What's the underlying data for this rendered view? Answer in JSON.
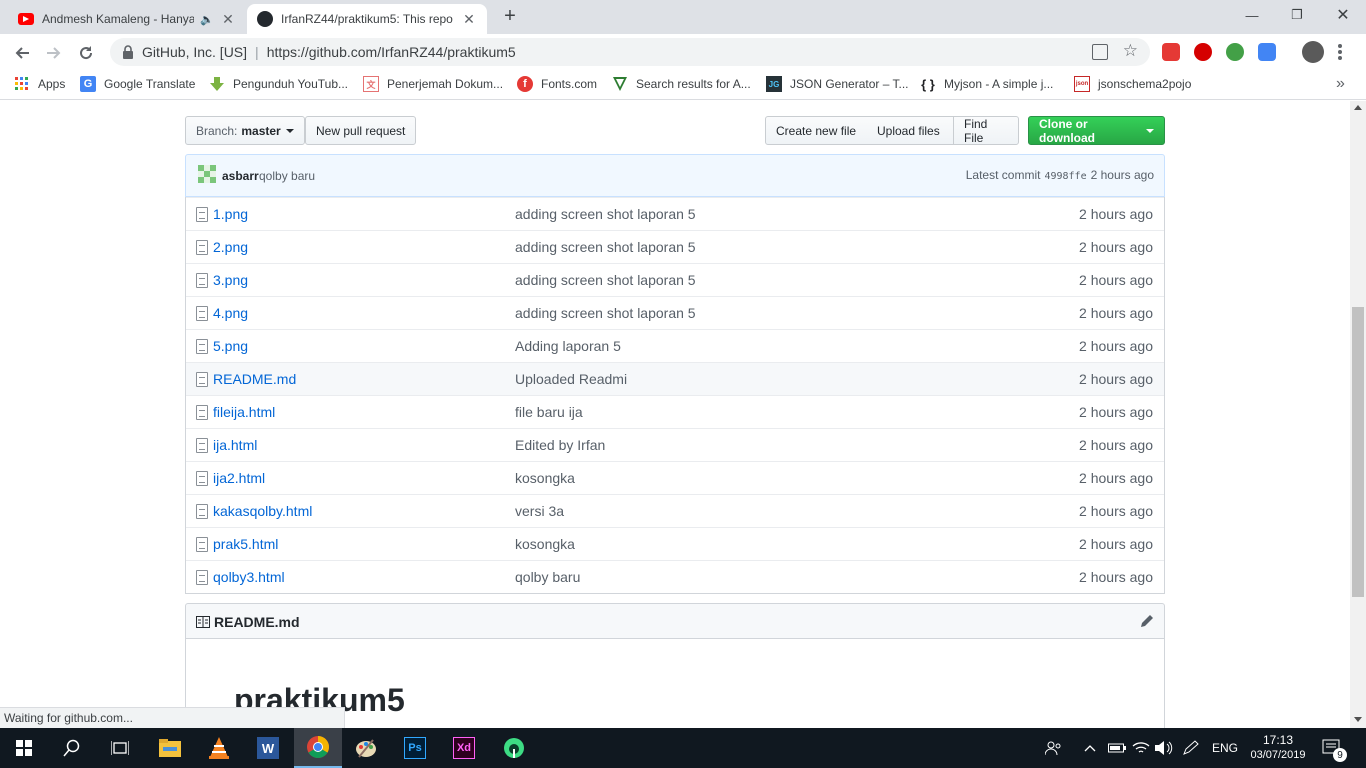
{
  "browser": {
    "tabs": [
      {
        "title": "Andmesh Kamaleng - Hanya",
        "icon": "youtube-icon",
        "audio_icon": "speaker-icon"
      },
      {
        "title": "IrfanRZ44/praktikum5: This repo",
        "icon": "github-icon"
      }
    ],
    "new_tab_symbol": "+",
    "window_controls": {
      "minimize": "—",
      "maximize": "❐",
      "close": "✕"
    },
    "omnibox": {
      "site_identity": "GitHub, Inc. [US]",
      "separator": "|",
      "url": "https://github.com/IrfanRZ44/praktikum5"
    },
    "bookmarks": [
      {
        "label": "Apps",
        "icon": "apps-grid-icon"
      },
      {
        "label": "Google Translate",
        "icon": "google-translate-icon"
      },
      {
        "label": "Pengunduh YouTub...",
        "icon": "download-arrow-icon"
      },
      {
        "label": "Penerjemah Dokum...",
        "icon": "document-translate-icon"
      },
      {
        "label": "Fonts.com",
        "icon": "fonts-icon"
      },
      {
        "label": "Search results for A...",
        "icon": "search-results-icon"
      },
      {
        "label": "JSON Generator – T...",
        "icon": "json-generator-icon"
      },
      {
        "label": "Myjson - A simple j...",
        "icon": "braces-icon"
      },
      {
        "label": "jsonschema2pojo",
        "icon": "json-icon"
      }
    ],
    "bookmarks_overflow": "»",
    "status_text": "Waiting for github.com..."
  },
  "repo": {
    "branch_label": "Branch:",
    "branch_name": "master",
    "new_pull_request": "New pull request",
    "create_new_file": "Create new file",
    "upload_files": "Upload files",
    "find_file": "Find File",
    "clone_or_download": "Clone or download",
    "commit": {
      "author": "asbarr",
      "message": "qolby baru",
      "latest_label": "Latest commit",
      "sha": "4998ffe",
      "time": "2 hours ago"
    },
    "files": [
      {
        "name": "1.png",
        "message": "adding screen shot laporan 5",
        "age": "2 hours ago"
      },
      {
        "name": "2.png",
        "message": "adding screen shot laporan 5",
        "age": "2 hours ago"
      },
      {
        "name": "3.png",
        "message": "adding screen shot laporan 5",
        "age": "2 hours ago"
      },
      {
        "name": "4.png",
        "message": "adding screen shot laporan 5",
        "age": "2 hours ago"
      },
      {
        "name": "5.png",
        "message": "Adding laporan 5",
        "age": "2 hours ago"
      },
      {
        "name": "README.md",
        "message": "Uploaded Readmi",
        "age": "2 hours ago"
      },
      {
        "name": "fileija.html",
        "message": "file baru ija",
        "age": "2 hours ago"
      },
      {
        "name": "ija.html",
        "message": "Edited by Irfan",
        "age": "2 hours ago"
      },
      {
        "name": "ija2.html",
        "message": "kosongka",
        "age": "2 hours ago"
      },
      {
        "name": "kakasqolby.html",
        "message": "versi 3a",
        "age": "2 hours ago"
      },
      {
        "name": "prak5.html",
        "message": "kosongka",
        "age": "2 hours ago"
      },
      {
        "name": "qolby3.html",
        "message": "qolby baru",
        "age": "2 hours ago"
      }
    ],
    "readme": {
      "filename": "README.md",
      "heading": "praktikum5"
    }
  },
  "taskbar": {
    "apps": [
      "start-icon",
      "search-icon",
      "task-view-icon",
      "file-explorer-icon",
      "vlc-icon",
      "word-icon",
      "chrome-icon",
      "paint-icon",
      "photoshop-icon",
      "xd-icon",
      "android-studio-icon"
    ],
    "photoshop_label": "Ps",
    "xd_label": "Xd",
    "language": "ENG",
    "time": "17:13",
    "date": "03/07/2019",
    "notification_count": "9"
  },
  "colors": {
    "link": "#0366d6",
    "green_button": "#28a745",
    "commit_bar": "#f1f8ff",
    "taskbar": "#101820"
  }
}
